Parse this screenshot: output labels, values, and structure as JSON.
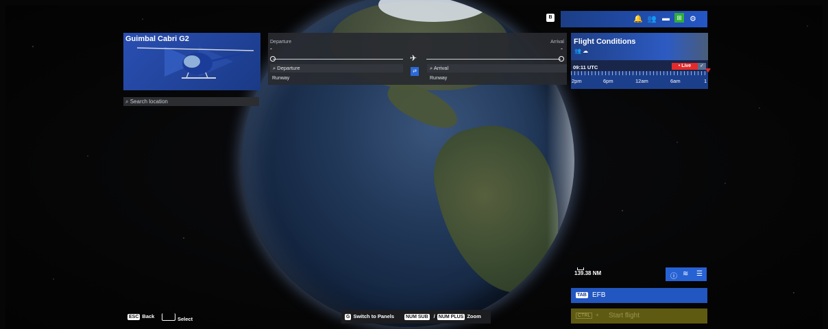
{
  "aircraft": {
    "name": "Guimbal Cabri G2"
  },
  "search": {
    "placeholder": "Search location"
  },
  "route": {
    "departure_label": "Departure",
    "arrival_label": "Arrival",
    "departure_code": "-",
    "arrival_code": "-",
    "departure_field": "Departure",
    "arrival_field": "Arrival",
    "departure_runway": "Runway",
    "arrival_runway": "Runway"
  },
  "topbar": {
    "b_key": "B",
    "icons": [
      "bell-icon",
      "friends-icon",
      "chat-icon",
      "marketplace-icon",
      "settings-icon"
    ]
  },
  "conditions": {
    "title": "Flight Conditions",
    "time": "09:11 UTC",
    "live_label": "• Live",
    "timeline": [
      "2pm",
      "6pm",
      "12am",
      "6am",
      "1"
    ]
  },
  "map": {
    "scale": "139.38 NM"
  },
  "efb": {
    "key": "TAB",
    "label": "EFB"
  },
  "start": {
    "key": "CTRL",
    "plus": "+",
    "label": "Start flight"
  },
  "hints": {
    "esc_key": "ESC",
    "back": "Back",
    "select_key": "",
    "select": "Select",
    "g_key": "G",
    "switch": "Switch to Panels",
    "numsub_key": "NUM SUB",
    "slash": "/",
    "numplus_key": "NUM PLUS",
    "zoom": "Zoom"
  },
  "colors": {
    "accent": "#2456c5",
    "live": "#e42a2a",
    "start_disabled": "#5f5a12"
  }
}
